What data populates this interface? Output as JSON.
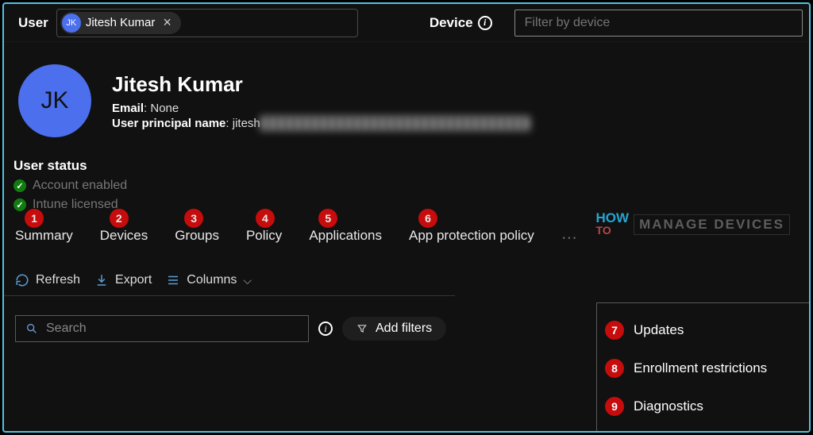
{
  "top": {
    "user_label": "User",
    "chip_initials": "JK",
    "chip_name": "Jitesh Kumar",
    "device_label": "Device",
    "device_filter_placeholder": "Filter by device"
  },
  "profile": {
    "avatar_initials": "JK",
    "name": "Jitesh Kumar",
    "email_label": "Email",
    "email_value": "None",
    "upn_label": "User principal name",
    "upn_prefix": "jitesh",
    "upn_redacted": "████████████████████████████████"
  },
  "status": {
    "title": "User status",
    "items": [
      "Account enabled",
      "Intune licensed"
    ]
  },
  "tabs": [
    {
      "n": "1",
      "label": "Summary"
    },
    {
      "n": "2",
      "label": "Devices"
    },
    {
      "n": "3",
      "label": "Groups"
    },
    {
      "n": "4",
      "label": "Policy"
    },
    {
      "n": "5",
      "label": "Applications"
    },
    {
      "n": "6",
      "label": "App protection policy"
    }
  ],
  "toolbar": {
    "refresh": "Refresh",
    "export": "Export",
    "columns": "Columns"
  },
  "search": {
    "placeholder": "Search",
    "add_filters": "Add filters"
  },
  "flyout": [
    {
      "n": "7",
      "label": "Updates"
    },
    {
      "n": "8",
      "label": "Enrollment restrictions"
    },
    {
      "n": "9",
      "label": "Diagnostics"
    }
  ],
  "watermark": {
    "a": "HOW",
    "b": "TO",
    "c": "MANAGE DEVICES"
  }
}
